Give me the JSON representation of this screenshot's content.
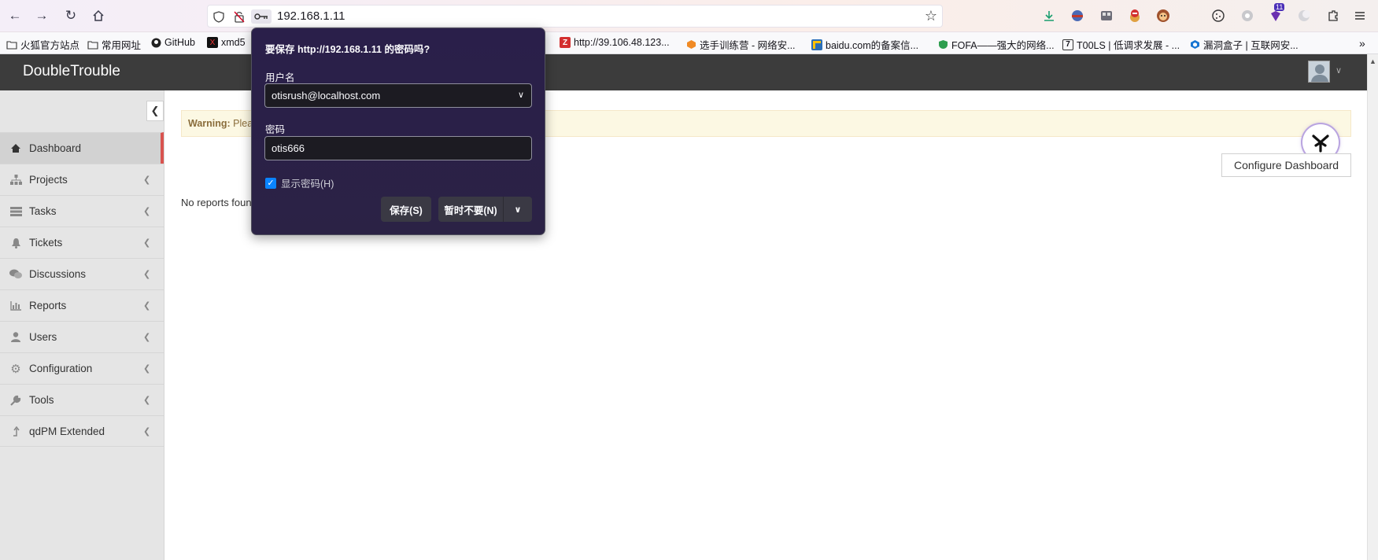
{
  "browser": {
    "url": "192.168.1.11",
    "extension_badge": "11",
    "bookmarks": [
      {
        "label": "火狐官方站点",
        "icon": "folder-icon"
      },
      {
        "label": "常用网址",
        "icon": "folder-icon"
      },
      {
        "label": "GitHub",
        "icon": "github-icon"
      },
      {
        "label": "xmd5",
        "icon": "xmd5-icon"
      },
      {
        "label": "http://39.106.48.123...",
        "icon": "z-icon"
      },
      {
        "label": "选手训练营 - 网络安...",
        "icon": "hexagon-icon"
      },
      {
        "label": "baidu.com的备案信...",
        "icon": "baidu-icon"
      },
      {
        "label": "FOFA——强大的网络...",
        "icon": "fofa-icon"
      },
      {
        "label": "T00LS | 低调求发展 - ...",
        "icon": "tools-icon"
      },
      {
        "label": "漏洞盒子 | 互联网安...",
        "icon": "cube-icon"
      }
    ]
  },
  "app": {
    "title": "DoubleTrouble"
  },
  "sidebar": {
    "items": [
      {
        "label": "Dashboard",
        "icon": "home-icon",
        "active": true
      },
      {
        "label": "Projects",
        "icon": "sitemap-icon"
      },
      {
        "label": "Tasks",
        "icon": "tasks-icon"
      },
      {
        "label": "Tickets",
        "icon": "bell-icon"
      },
      {
        "label": "Discussions",
        "icon": "comments-icon"
      },
      {
        "label": "Reports",
        "icon": "bar-chart-icon"
      },
      {
        "label": "Users",
        "icon": "user-icon"
      },
      {
        "label": "Configuration",
        "icon": "gear-icon"
      },
      {
        "label": "Tools",
        "icon": "wrench-icon"
      },
      {
        "label": "qdPM Extended",
        "icon": "level-up-icon"
      }
    ]
  },
  "main": {
    "warning_strong": "Warning:",
    "warning_text": " Plea",
    "configure_label": "Configure Dashboard",
    "no_reports": "No reports foun"
  },
  "password_dialog": {
    "title": "要保存 http://192.168.1.11 的密码吗?",
    "username_label": "用户名",
    "username_value": "otisrush@localhost.com",
    "password_label": "密码",
    "password_value": "otis666",
    "show_password_label": "显示密码(H)",
    "show_password_checked": true,
    "save_label": "保存(S)",
    "not_now_label": "暂时不要(N)"
  }
}
